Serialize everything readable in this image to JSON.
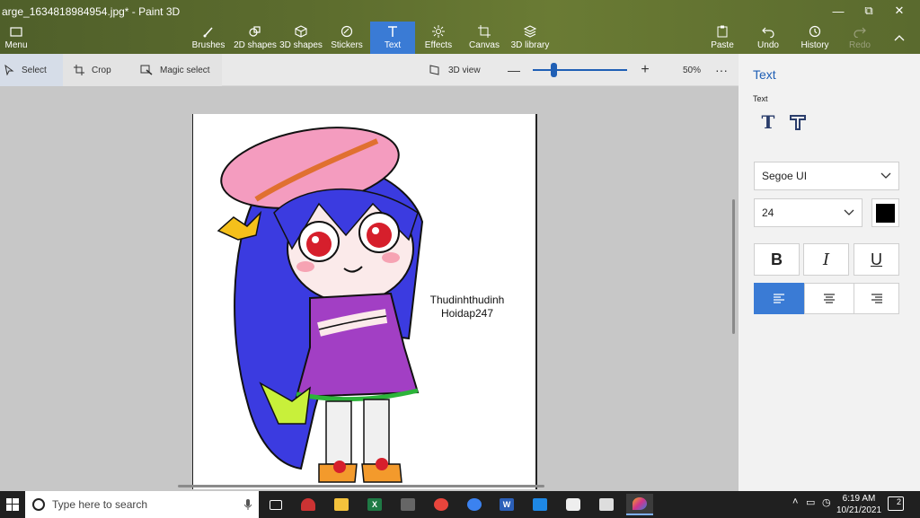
{
  "window": {
    "title": "arge_1634818984954.jpg* - Paint 3D"
  },
  "ribbon": {
    "menu": "Menu",
    "items": [
      {
        "label": "Brushes",
        "icon": "brush-icon"
      },
      {
        "label": "2D shapes",
        "icon": "shapes-2d-icon"
      },
      {
        "label": "3D shapes",
        "icon": "cube-icon"
      },
      {
        "label": "Stickers",
        "icon": "sticker-icon"
      },
      {
        "label": "Text",
        "icon": "text-icon"
      },
      {
        "label": "Effects",
        "icon": "effects-icon"
      },
      {
        "label": "Canvas",
        "icon": "canvas-icon"
      },
      {
        "label": "3D library",
        "icon": "library-icon"
      }
    ],
    "right": [
      {
        "label": "Paste",
        "icon": "paste-icon"
      },
      {
        "label": "Undo",
        "icon": "undo-icon"
      },
      {
        "label": "History",
        "icon": "history-icon"
      },
      {
        "label": "Redo",
        "icon": "redo-icon"
      }
    ]
  },
  "toolbar": {
    "select": "Select",
    "crop": "Crop",
    "magic_select": "Magic select",
    "view_3d": "3D view",
    "zoom": "50%",
    "more": "···",
    "zoom_level_fraction": 0.22
  },
  "canvas": {
    "text_line1": "Thudinhthudinh",
    "text_line2": "Hoidap247"
  },
  "panel": {
    "title": "Text",
    "subtitle": "Text",
    "font": "Segoe UI",
    "size": "24",
    "bold": "B",
    "italic": "I",
    "underline": "U",
    "color": "#000000"
  },
  "taskbar": {
    "search_placeholder": "Type here to search",
    "time": "6:19 AM",
    "date": "10/21/2021",
    "notifications": "2"
  },
  "colors": {
    "accent": "#3a7bd5",
    "ribbon": "#5d6d2e"
  }
}
